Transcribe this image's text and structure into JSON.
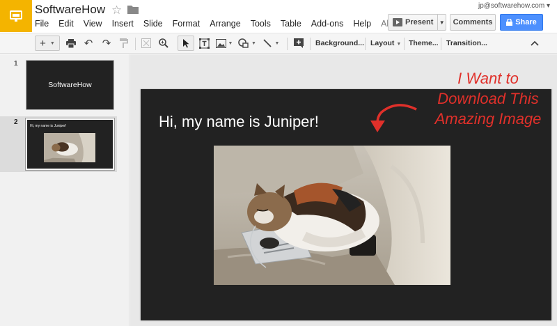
{
  "header": {
    "doc_title": "SoftwareHow",
    "account": "jp@softwarehow.com",
    "present_label": "Present",
    "comments_label": "Comments",
    "share_label": "Share"
  },
  "menu": [
    "File",
    "Edit",
    "View",
    "Insert",
    "Slide",
    "Format",
    "Arrange",
    "Tools",
    "Table",
    "Add-ons",
    "Help",
    "All ch..."
  ],
  "toolbar": {
    "background": "Background...",
    "layout": "Layout",
    "theme": "Theme...",
    "transition": "Transition..."
  },
  "filmstrip": {
    "slides": [
      {
        "num": "1",
        "text": "SoftwareHow"
      },
      {
        "num": "2",
        "text": "Hi, my name is Juniper!"
      }
    ]
  },
  "slide": {
    "title": "Hi, my name is Juniper!"
  },
  "annotation": {
    "line1": "I Want to",
    "line2": "Download This",
    "line3": "Amazing Image"
  },
  "colors": {
    "logo": "#f4b400",
    "share": "#4d90fe",
    "slide_bg": "#222222",
    "annotation": "#e0302a"
  }
}
